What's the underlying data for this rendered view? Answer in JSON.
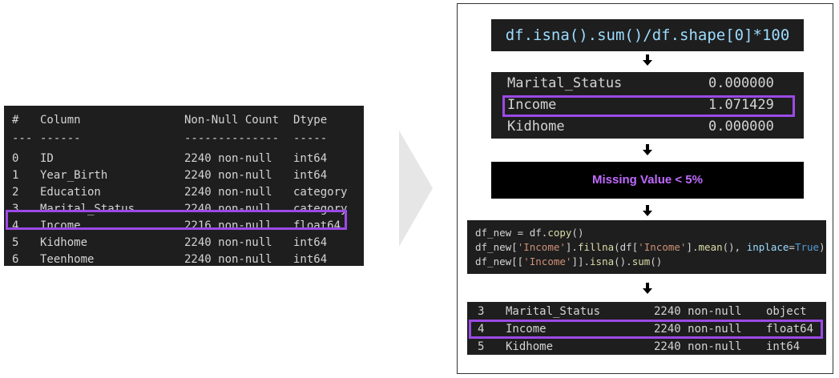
{
  "left_table": {
    "headers": [
      "#",
      "Column",
      "Non-Null Count",
      "Dtype"
    ],
    "separators": [
      "---",
      "------",
      "--------------",
      "-----"
    ],
    "rows": [
      [
        "0",
        "ID",
        "2240 non-null",
        "int64"
      ],
      [
        "1",
        "Year_Birth",
        "2240 non-null",
        "int64"
      ],
      [
        "2",
        "Education",
        "2240 non-null",
        "category"
      ],
      [
        "3",
        "Marital_Status",
        "2240 non-null",
        "category"
      ],
      [
        "4",
        "Income",
        "2216 non-null",
        "float64"
      ],
      [
        "5",
        "Kidhome",
        "2240 non-null",
        "int64"
      ],
      [
        "6",
        "Teenhome",
        "2240 non-null",
        "int64"
      ]
    ],
    "highlighted_row": "4"
  },
  "right": {
    "code1": "df.isna().sum()/df.shape[0]*100",
    "isna_rows": [
      [
        "Marital_Status",
        "0.000000"
      ],
      [
        "Income",
        "1.071429"
      ],
      [
        "Kidhome",
        "0.000000"
      ]
    ],
    "missing_label": "Missing Value < 5%",
    "code2_lines": [
      "df_new = df.copy()",
      "df_new['Income'].fillna(df['Income'].mean(), inplace=True)",
      "df_new[['Income']].isna().sum()"
    ],
    "bottom_rows": [
      [
        "3",
        "Marital_Status",
        "2240 non-null",
        "object"
      ],
      [
        "4",
        "Income",
        "2240 non-null",
        "float64"
      ],
      [
        "5",
        "Kidhome",
        "2240 non-null",
        "int64"
      ]
    ]
  },
  "colors": {
    "highlight": "#9b4ae6",
    "code_bg": "#1e1e1e",
    "missing_text": "#c06bff"
  }
}
